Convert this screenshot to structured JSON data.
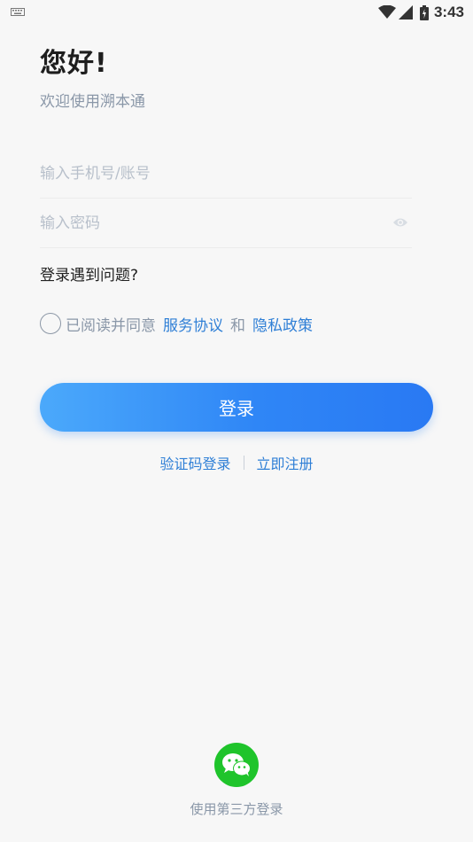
{
  "status_bar": {
    "time": "3:43",
    "icons": [
      "keyboard-icon",
      "wifi-icon",
      "signal-icon",
      "battery-icon"
    ]
  },
  "header": {
    "greeting": "您好!",
    "subtitle": "欢迎使用溯本通"
  },
  "form": {
    "account_placeholder": "输入手机号/账号",
    "account_value": "",
    "password_placeholder": "输入密码",
    "password_value": "",
    "trouble_label": "登录遇到问题?"
  },
  "agreement": {
    "prefix": "已阅读并同意",
    "service_link": "服务协议",
    "and": "和",
    "privacy_link": "隐私政策",
    "checked": false
  },
  "actions": {
    "login_label": "登录",
    "sms_login_label": "验证码登录",
    "register_label": "立即注册"
  },
  "third_party": {
    "label": "使用第三方登录",
    "icon": "wechat-icon"
  },
  "colors": {
    "accent": "#2f7fd6",
    "button_gradient_start": "#4ba9fb",
    "button_gradient_end": "#2979f3",
    "wechat_green": "#1fc42b"
  }
}
